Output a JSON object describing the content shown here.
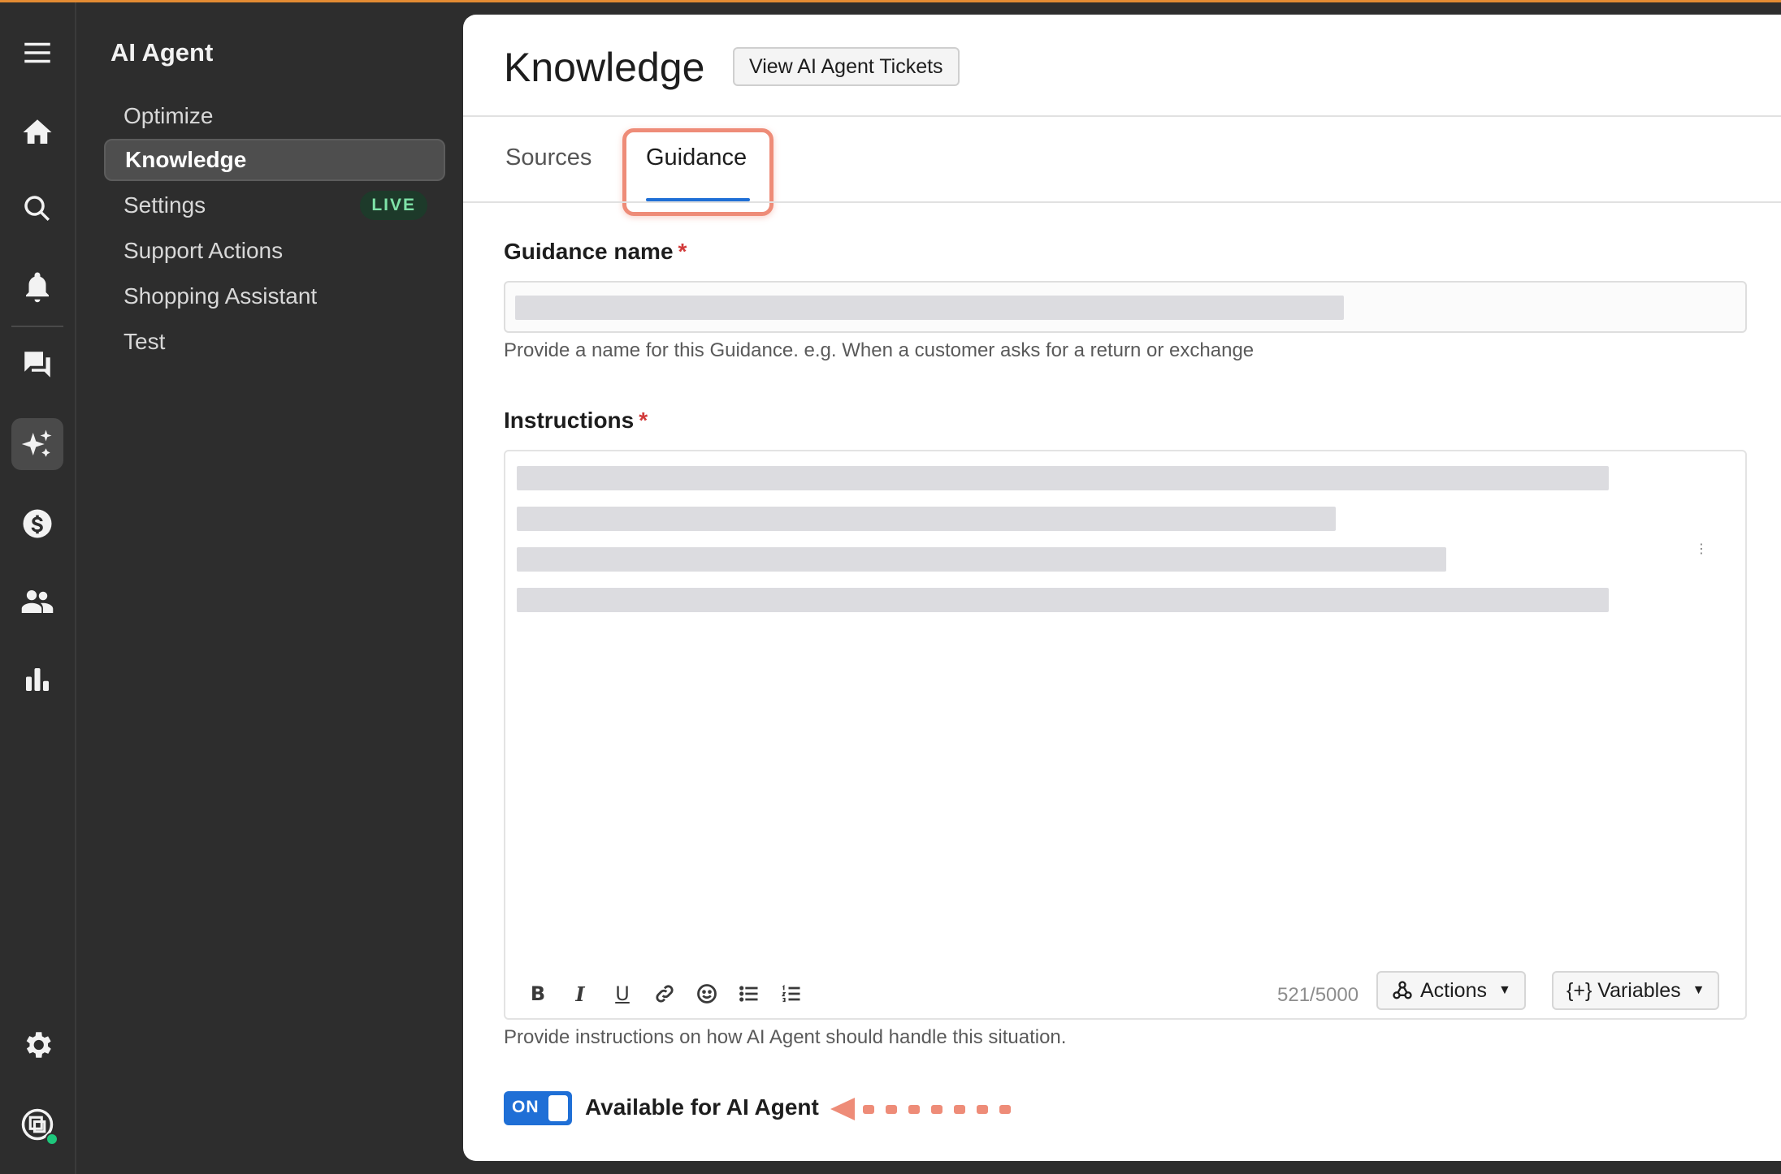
{
  "rail": {
    "items": [
      {
        "name": "menu-icon"
      },
      {
        "name": "home-icon"
      },
      {
        "name": "search-icon"
      },
      {
        "name": "bell-icon"
      },
      {
        "name": "chat-icon"
      },
      {
        "name": "ai-sparkle-icon",
        "active": true
      },
      {
        "name": "dollar-icon"
      },
      {
        "name": "users-icon"
      },
      {
        "name": "stats-icon"
      },
      {
        "name": "settings-gear-icon"
      },
      {
        "name": "account-icon"
      }
    ]
  },
  "nav": {
    "title": "AI Agent",
    "items": [
      {
        "label": "Optimize"
      },
      {
        "label": "Knowledge",
        "active": true
      },
      {
        "label": "Settings",
        "badge": "LIVE"
      },
      {
        "label": "Support Actions"
      },
      {
        "label": "Shopping Assistant"
      },
      {
        "label": "Test"
      }
    ]
  },
  "header": {
    "title": "Knowledge",
    "tickets_button": "View AI Agent Tickets"
  },
  "tabs": [
    {
      "label": "Sources"
    },
    {
      "label": "Guidance",
      "active": true
    }
  ],
  "form": {
    "name_label": "Guidance name",
    "required_mark": "*",
    "name_help": "Provide a name for this Guidance. e.g. When a customer asks for a return or exchange",
    "instructions_label": "Instructions",
    "instructions_help": "Provide instructions on how AI Agent should handle this situation.",
    "char_counter": "521/5000",
    "actions_button": "Actions",
    "variables_button": "{+} Variables",
    "toolbar": [
      "bold",
      "italic",
      "underline",
      "link",
      "emoji",
      "bullet-list",
      "numbered-list"
    ]
  },
  "toggle": {
    "state": "ON",
    "label": "Available for AI Agent"
  },
  "colors": {
    "accent": "#1f6fd6",
    "highlight": "#ee8c78",
    "live_badge_bg": "#1d3a2a",
    "live_badge_text": "#7fe3a8"
  }
}
